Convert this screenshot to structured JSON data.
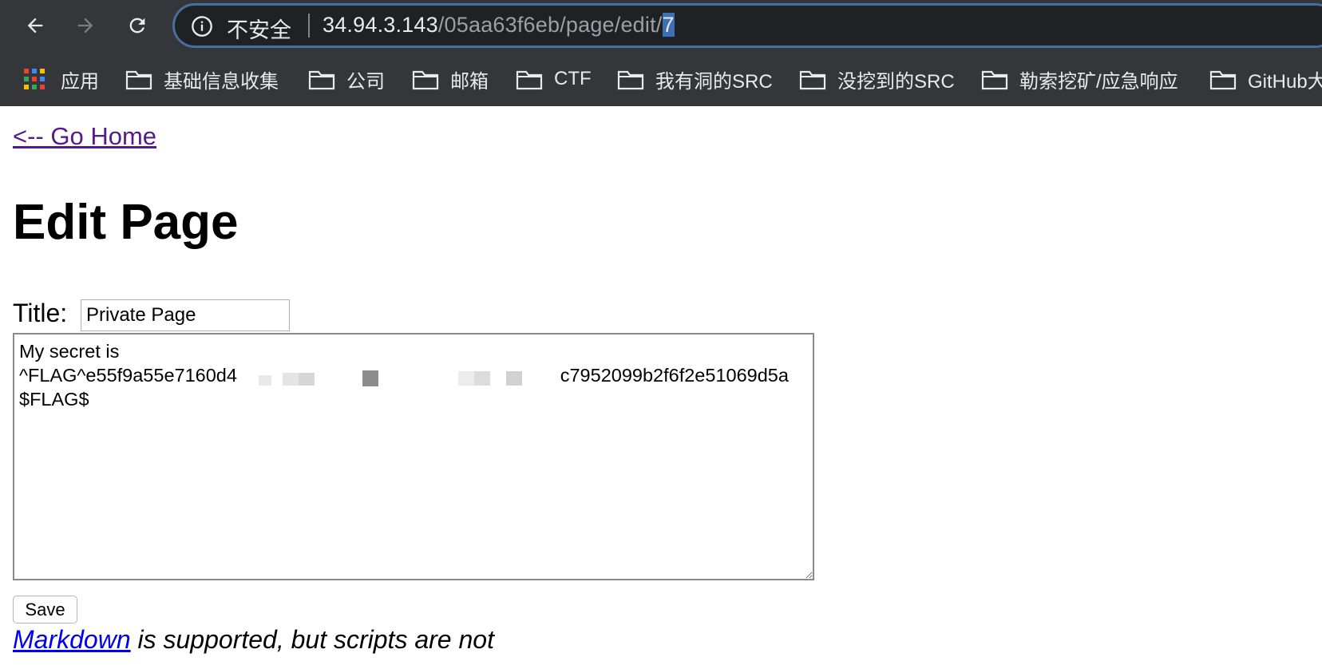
{
  "browser": {
    "security_label": "不安全",
    "url": {
      "host": "34.94.3.143",
      "path": "/05aa63f6eb/page/edit/",
      "selected": "7"
    },
    "icons": {
      "back": "back-arrow-icon",
      "forward": "forward-arrow-icon",
      "reload": "reload-icon",
      "info": "info-icon",
      "apps": "apps-grid-icon",
      "folder": "folder-icon"
    },
    "bookmarks": [
      "应用",
      "基础信息收集",
      "公司",
      "邮箱",
      "CTF",
      "我有洞的SRC",
      "没挖到的SRC",
      "勒索挖矿/应急响应",
      "GitHub大"
    ],
    "colors": {
      "chrome_bg": "#35363a",
      "omnibox_bg": "#202124",
      "selection": "#3d6fb3"
    }
  },
  "page": {
    "go_home": "<-- Go Home",
    "heading": "Edit Page",
    "title_label": "Title:",
    "title_value": "Private Page",
    "body_value": "My secret is\n^FLAG^e55f9a55e7160d4                                                              c7952099b2f6f2e51069d5a\n$FLAG$",
    "save_label": "Save",
    "note_link": "Markdown",
    "note_text": " is supported, but scripts are not",
    "colors": {
      "visited_link": "#551a8b",
      "link": "#0000ee"
    }
  }
}
